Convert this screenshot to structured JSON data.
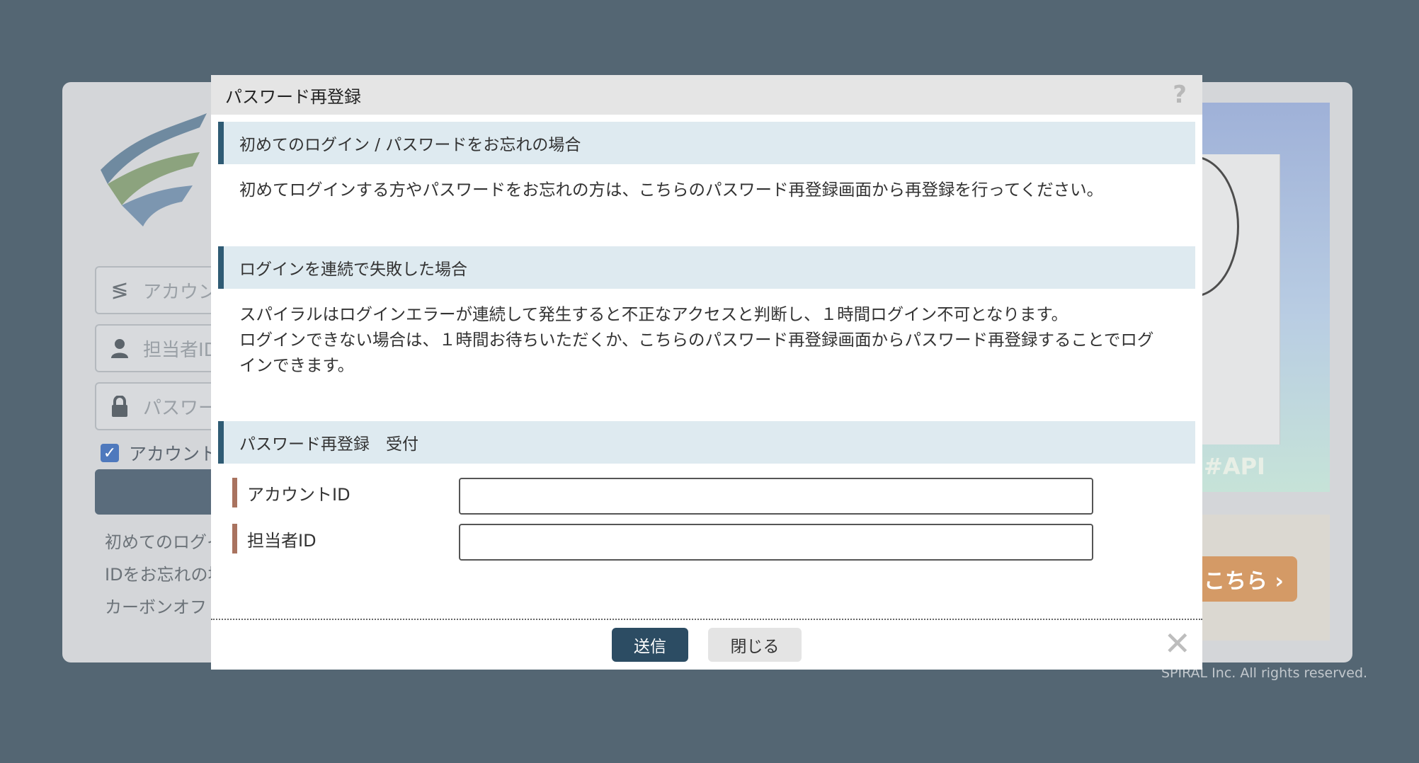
{
  "modal": {
    "title": "パスワード再登録",
    "help_icon": "?",
    "sections": [
      {
        "heading": "初めてのログイン / パスワードをお忘れの場合",
        "text": "初めてログインする方やパスワードをお忘れの方は、こちらのパスワード再登録画面から再登録を行ってください。"
      },
      {
        "heading": "ログインを連続で失敗した場合",
        "text_line1": "スパイラルはログインエラーが連続して発生すると不正なアクセスと判断し、１時間ログイン不可となります。",
        "text_line2": "ログインできない場合は、１時間お待ちいただくか、こちらのパスワード再登録画面からパスワード再登録することでログ",
        "text_line3": "インできます。"
      },
      {
        "heading": "パスワード再登録　受付"
      }
    ],
    "form": {
      "account_id_label": "アカウントID",
      "account_id_value": "",
      "staff_id_label": "担当者ID",
      "staff_id_value": ""
    },
    "footer": {
      "send_label": "送信",
      "close_label": "閉じる",
      "close_icon": "✕"
    }
  },
  "background": {
    "account_placeholder": "アカウン",
    "staff_placeholder": "担当者ID",
    "password_placeholder": "パスワー",
    "remember_label": "アカウント",
    "link1": "初めてのログイ",
    "link2": "IDをお忘れの場",
    "link3": "カーボンオフ",
    "api_text": "#API",
    "banner_button": "こちら ›",
    "copyright": "SPIRAL Inc. All rights reserved."
  },
  "colors": {
    "backdrop": "#546673",
    "section_accent": "#2f5b74",
    "label_accent": "#a9735f",
    "send_button": "#2c4c63"
  }
}
